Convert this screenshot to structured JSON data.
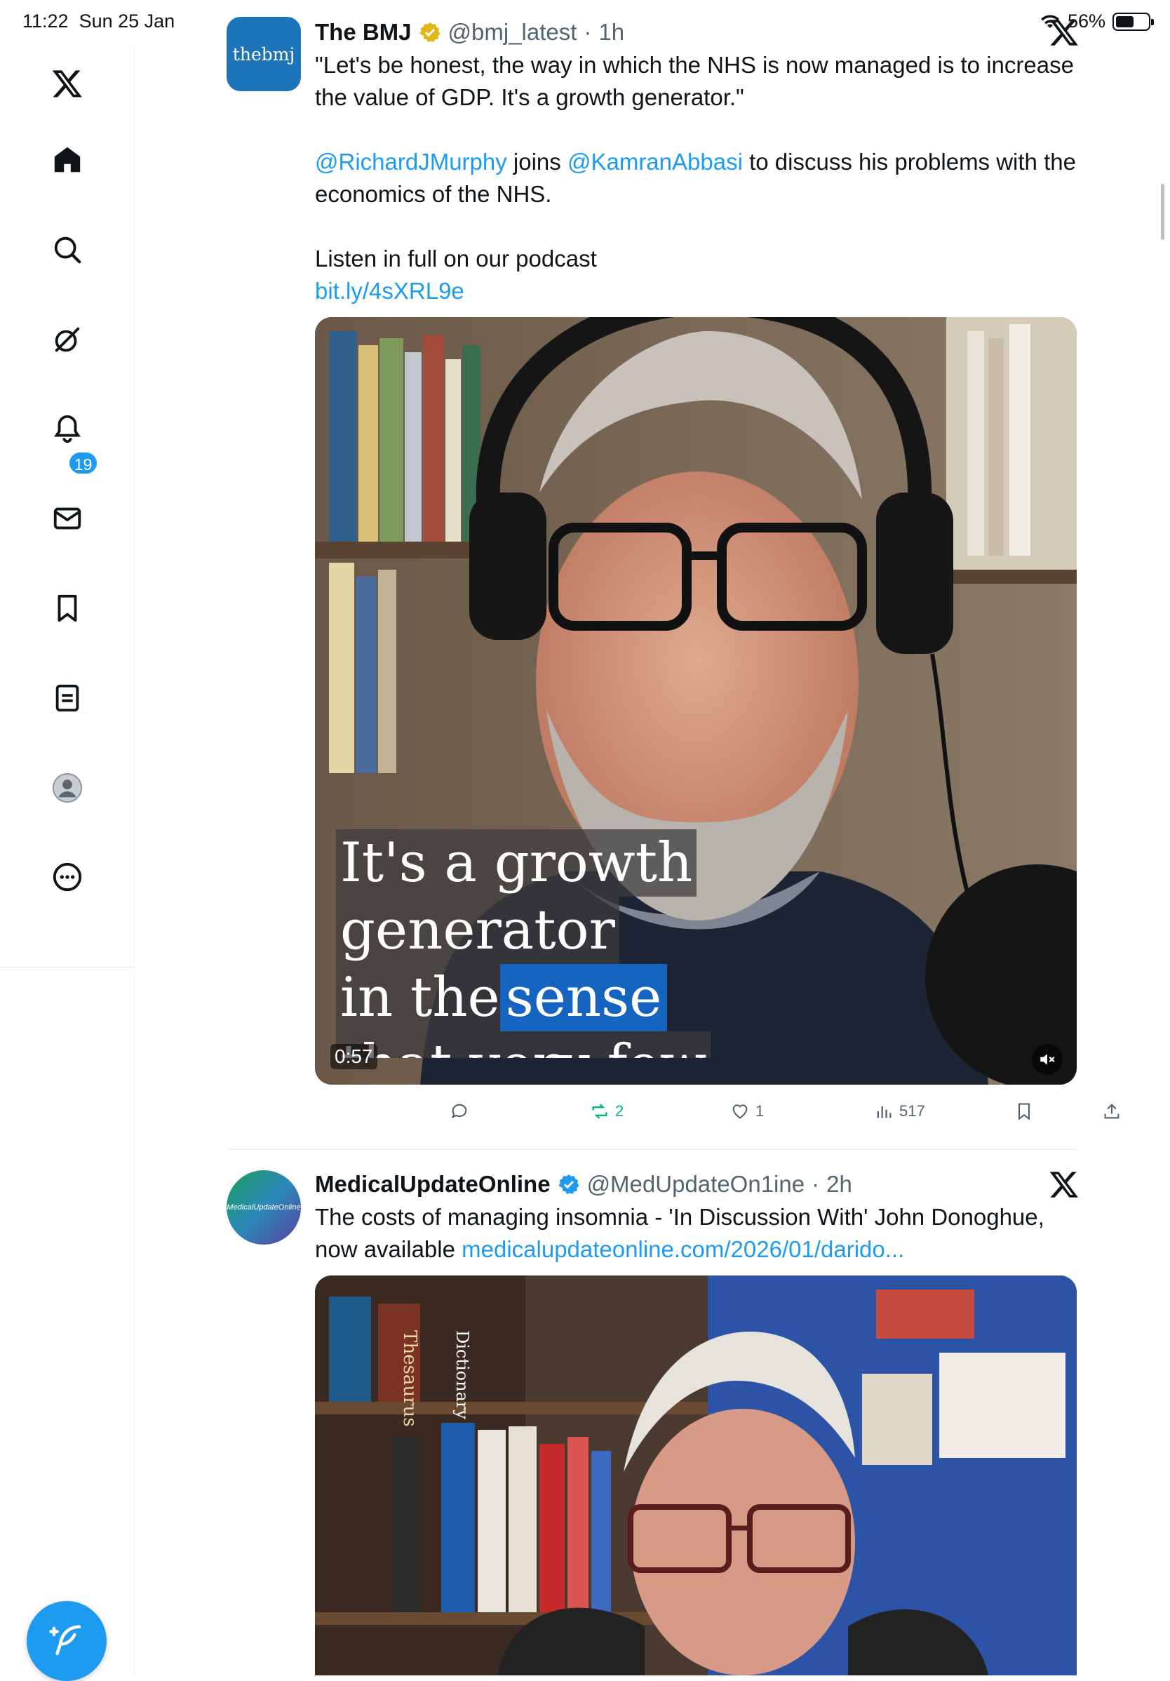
{
  "status_bar": {
    "time": "11:22",
    "date": "Sun 25 Jan",
    "battery": "56%",
    "battery_level": 0.56
  },
  "sidebar": {
    "items": [
      {
        "icon": "x-logo-icon"
      },
      {
        "icon": "home-icon"
      },
      {
        "icon": "search-icon"
      },
      {
        "icon": "grok-icon"
      },
      {
        "icon": "notifications-icon"
      },
      {
        "icon": "messages-icon"
      },
      {
        "icon": "bookmarks-icon"
      },
      {
        "icon": "lists-icon"
      },
      {
        "icon": "profile-avatar-icon"
      },
      {
        "icon": "more-icon"
      }
    ],
    "notification_count": "19",
    "compose_icon": "compose-post-icon"
  },
  "tweets": [
    {
      "avatar_text": "thebmj",
      "name": "The BMJ",
      "handle": "@bmj_latest",
      "dot": "·",
      "time": "1h",
      "verified": "gold",
      "text_line1": "\"Let's be honest, the way in which the NHS is now managed is to increase the value of GDP. It's a growth generator.\"",
      "mention1": "@RichardJMurphy",
      "joins": " joins ",
      "mention2": "@KamranAbbasi",
      "text_line2_rest": " to discuss his problems with the economics of the NHS.",
      "listen": "Listen in full on our podcast",
      "link": "bit.ly/4sXRL9e",
      "video": {
        "caption_l1": "It's a growth",
        "caption_l2": "generator",
        "caption_l3a": "in the ",
        "caption_l3b": "sense",
        "caption_l4": "that very few",
        "duration": "0:57"
      },
      "actions": {
        "replies": "",
        "reposts": "2",
        "likes": "1",
        "views": "517"
      }
    },
    {
      "avatar_text": "MedicalUpdateOnline",
      "name": "MedicalUpdateOnline",
      "handle": "@MedUpdateOn1ine",
      "dot": "·",
      "time": "2h",
      "verified": "blue",
      "text": "The costs of managing insomnia - 'In Discussion With' John Donoghue, now available ",
      "link": "medicalupdateonline.com/2026/01/darido...",
      "books": [
        "Thesaurus",
        "Dictionary"
      ]
    }
  ],
  "colors": {
    "accent": "#1d9bf0",
    "repost": "#00ba7c",
    "bmj": "#1e74b8",
    "gold": "#e2b719"
  }
}
